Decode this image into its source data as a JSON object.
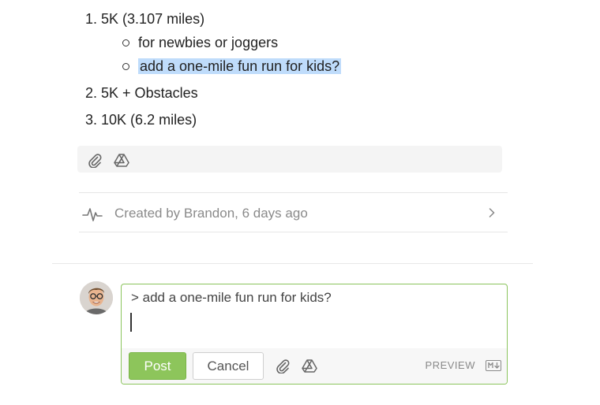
{
  "list": {
    "items": [
      {
        "num": "1.",
        "text": "5K (3.107 miles)"
      },
      {
        "num": "2.",
        "text": "5K + Obstacles"
      },
      {
        "num": "3.",
        "text": "10K (6.2 miles)"
      }
    ],
    "subitems": [
      "for newbies or joggers",
      "add a one-mile fun run for kids?"
    ]
  },
  "attachments": {
    "icons": [
      "paperclip-icon",
      "google-drive-icon"
    ]
  },
  "activity": {
    "text": "Created by Brandon, 6 days ago",
    "icon": "activity-pulse-icon"
  },
  "composer": {
    "text": "> add a one-mile fun run for kids?",
    "post_label": "Post",
    "cancel_label": "Cancel",
    "preview_label": "PREVIEW",
    "accent_color": "#8dc55b"
  }
}
